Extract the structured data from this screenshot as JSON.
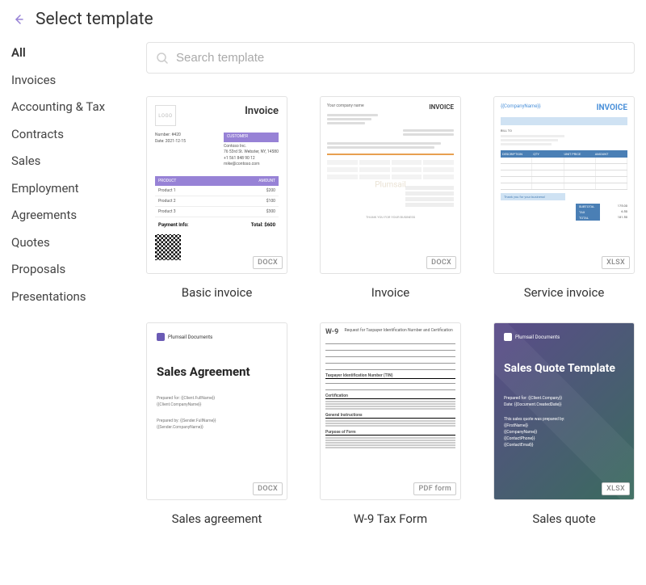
{
  "header": {
    "title": "Select template"
  },
  "search": {
    "placeholder": "Search template"
  },
  "sidebar": {
    "items": [
      {
        "label": "All",
        "active": true
      },
      {
        "label": "Invoices"
      },
      {
        "label": "Accounting & Tax"
      },
      {
        "label": "Contracts"
      },
      {
        "label": "Sales"
      },
      {
        "label": "Employment"
      },
      {
        "label": "Agreements"
      },
      {
        "label": "Quotes"
      },
      {
        "label": "Proposals"
      },
      {
        "label": "Presentations"
      }
    ]
  },
  "templates": [
    {
      "title": "Basic invoice",
      "badge": "DOCX"
    },
    {
      "title": "Invoice",
      "badge": "DOCX"
    },
    {
      "title": "Service invoice",
      "badge": "XLSX"
    },
    {
      "title": "Sales agreement",
      "badge": "DOCX"
    },
    {
      "title": "W-9 Tax Form",
      "badge": "PDF form"
    },
    {
      "title": "Sales quote",
      "badge": "XLSX"
    }
  ],
  "thumb_basic": {
    "logo": "LOGO",
    "heading": "Invoice",
    "customer_label": "CUSTOMER",
    "number": "Number: #420",
    "date": "Date: 2021-12-15",
    "addr1": "Contoso Inc.",
    "addr2": "76 53rd St. Webster, NY, 14580",
    "addr3": "+1 561 848 90 12",
    "addr4": "mike@contoso.com",
    "col1": "PRODUCT",
    "col2": "AMOUNT",
    "p1": "Product 1",
    "a1": "$200",
    "p2": "Product 2",
    "a2": "$100",
    "p3": "Product 3",
    "a3": "$300",
    "payment": "Payment Info:",
    "total_label": "Total: $600"
  },
  "thumb_inv": {
    "company": "Your company name",
    "heading": "INVOICE",
    "watermark": "Plumsail",
    "footer": "THANK YOU FOR YOUR BUSINESS"
  },
  "thumb_xlsx": {
    "company": "{{CompanyName}}",
    "heading": "INVOICE",
    "billto": "BILL TO",
    "desc": "DESCRIPTION",
    "qty": "QTY",
    "unit": "UNIT PRICE",
    "amount": "AMOUNT",
    "thank": "Thank you for your business!",
    "subtotal": "SUBTOTAL",
    "tax": "TAX",
    "total": "TOTAL"
  },
  "thumb_sa": {
    "brand": "Plumsail Documents",
    "heading": "Sales Agreement",
    "prep1": "Prepared for: {{Client.FullName}}\n{{Client.CompanyName}}",
    "prep2": "Prepared by: {{Sender.FullName}}\n{{Sender.CompanyName}}"
  },
  "thumb_w9": {
    "code": "W-9",
    "title": "Request for Taxpayer Identification Number and Certification",
    "sec1": "Taxpayer Identification Number (TIN)",
    "sec2": "Certification",
    "sec3": "General Instructions",
    "sec4": "Purpose of Form"
  },
  "thumb_sq": {
    "brand": "Plumsail Documents",
    "heading": "Sales Quote Template",
    "meta1": "Prepared for: {{Client.Company}}\nDate: {{Document.CreatedDate}}",
    "meta2": "This sales quote was prepared by:\n{{FirstName}}\n{{CompanyName}}\n{{ContactPhone}}\n{{ContactEmail}}"
  }
}
